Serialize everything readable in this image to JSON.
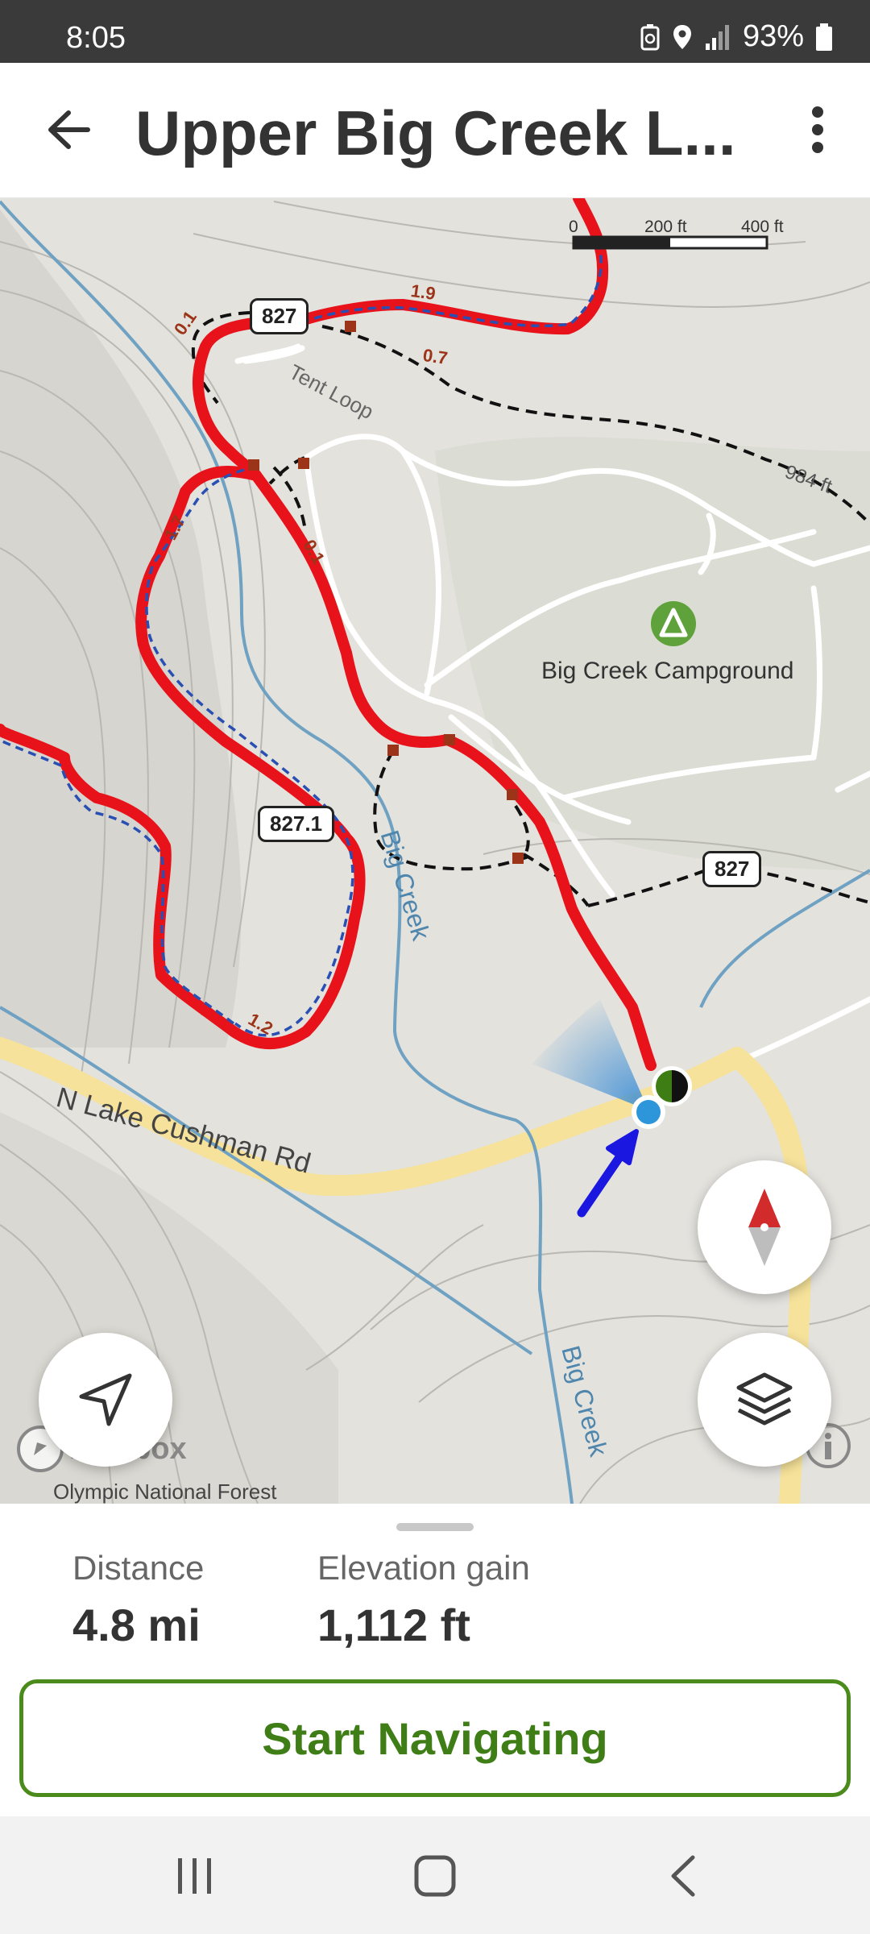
{
  "status_bar": {
    "time": "8:05",
    "battery": "93%"
  },
  "header": {
    "title": "Upper Big Creek L..."
  },
  "map": {
    "labels": {
      "campground": "Big Creek Campground",
      "tent_loop": "Tent Loop",
      "creek_upper": "Big Creek",
      "creek_lower": "Big Creek",
      "road": "N Lake Cushman Rd",
      "forest": "Olympic National Forest",
      "contour": "984 ft",
      "mapbox": "mapbox"
    },
    "shields": {
      "shield_827_top": "827",
      "shield_827_1": "827.1",
      "shield_827_right": "827"
    },
    "segment_labels": {
      "s1": "1.9",
      "s2": "0.7",
      "s3": "0.1",
      "s4": "0.1",
      "s5": "1.7",
      "s6": "1.2"
    },
    "scale": {
      "zero": "0",
      "mid": "200 ft",
      "max": "400 ft"
    },
    "colors": {
      "trail": "#e8121b",
      "route": "#2a4fb3",
      "creek": "#6fa1c2",
      "road": "#f6e29a",
      "campground": "#5fa13a"
    }
  },
  "stats": {
    "distance_label": "Distance",
    "distance_value": "4.8 mi",
    "elevation_label": "Elevation gain",
    "elevation_value": "1,112 ft"
  },
  "actions": {
    "start_navigating": "Start Navigating"
  }
}
